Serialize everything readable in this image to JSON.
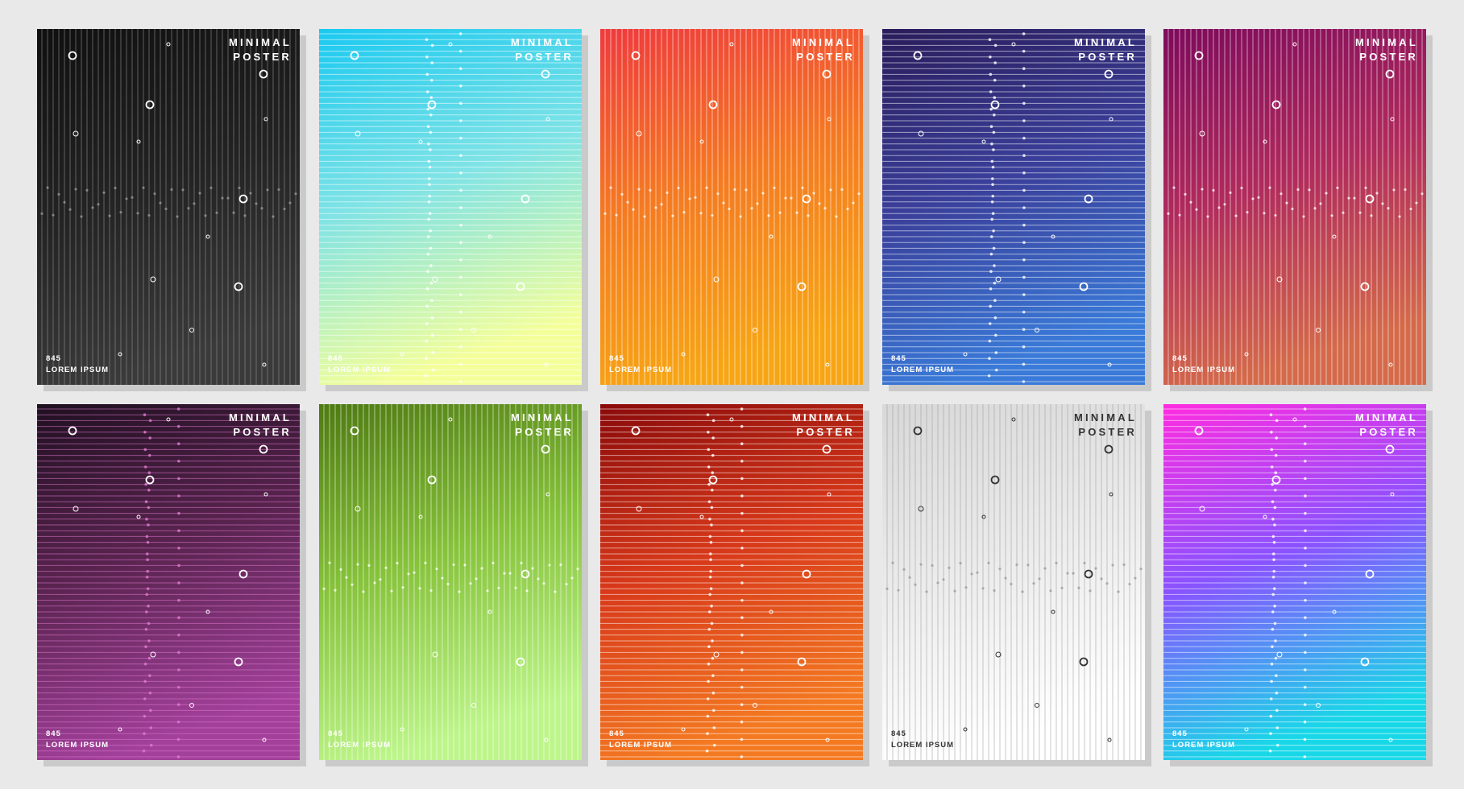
{
  "posters": [
    {
      "id": "black",
      "title_line1": "MINIMAL",
      "title_line2": "POSTER",
      "number": "845",
      "caption": "LOREM IPSUM",
      "orientation": "vertical",
      "gradient": [
        "#101010",
        "#222222",
        "#3a3a3a"
      ],
      "line_color": "#9a9a9a",
      "text_color": "#ffffff",
      "circle_color": "#ffffff"
    },
    {
      "id": "cyan",
      "title_line1": "MINIMAL",
      "title_line2": "POSTER",
      "number": "845",
      "caption": "LOREM IPSUM",
      "orientation": "horizontal",
      "gradient": [
        "#1ac9f0",
        "#7fe3e6",
        "#f4ff9a"
      ],
      "line_color": "#ffffff",
      "text_color": "#ffffff",
      "circle_color": "#ffffff"
    },
    {
      "id": "orange",
      "title_line1": "MINIMAL",
      "title_line2": "POSTER",
      "number": "845",
      "caption": "LOREM IPSUM",
      "orientation": "vertical",
      "gradient": [
        "#ef3a3d",
        "#f47a22",
        "#f7a514"
      ],
      "line_color": "#ffffff",
      "text_color": "#ffffff",
      "circle_color": "#ffffff"
    },
    {
      "id": "indigo",
      "title_line1": "MINIMAL",
      "title_line2": "POSTER",
      "number": "845",
      "caption": "LOREM IPSUM",
      "orientation": "horizontal",
      "gradient": [
        "#2a1c5a",
        "#3a3f9a",
        "#3a7ad8"
      ],
      "line_color": "#ffffff",
      "text_color": "#ffffff",
      "circle_color": "#ffffff"
    },
    {
      "id": "magenta",
      "title_line1": "MINIMAL",
      "title_line2": "POSTER",
      "number": "845",
      "caption": "LOREM IPSUM",
      "orientation": "vertical",
      "gradient": [
        "#7e0a5c",
        "#b02a5c",
        "#d46a4a"
      ],
      "line_color": "#ffffff",
      "text_color": "#ffffff",
      "circle_color": "#ffffff"
    },
    {
      "id": "plum",
      "title_line1": "MINIMAL",
      "title_line2": "POSTER",
      "number": "845",
      "caption": "LOREM IPSUM",
      "orientation": "horizontal",
      "gradient": [
        "#1f1020",
        "#5a2450",
        "#a2409a"
      ],
      "line_color": "#e07ad0",
      "text_color": "#ffffff",
      "circle_color": "#ffffff"
    },
    {
      "id": "green",
      "title_line1": "MINIMAL",
      "title_line2": "POSTER",
      "number": "845",
      "caption": "LOREM IPSUM",
      "orientation": "vertical",
      "gradient": [
        "#4e7a12",
        "#86c23a",
        "#bdf58a"
      ],
      "line_color": "#ffffff",
      "text_color": "#ffffff",
      "circle_color": "#ffffff"
    },
    {
      "id": "red",
      "title_line1": "MINIMAL",
      "title_line2": "POSTER",
      "number": "845",
      "caption": "LOREM IPSUM",
      "orientation": "horizontal",
      "gradient": [
        "#8a0a0a",
        "#d8391a",
        "#f47a22"
      ],
      "line_color": "#ffffff",
      "text_color": "#ffffff",
      "circle_color": "#ffffff"
    },
    {
      "id": "white",
      "title_line1": "MINIMAL",
      "title_line2": "POSTER",
      "number": "845",
      "caption": "LOREM IPSUM",
      "orientation": "vertical",
      "gradient": [
        "#d8d8d8",
        "#ebebeb",
        "#ffffff"
      ],
      "line_color": "#9a9a9a",
      "text_color": "#333333",
      "circle_color": "#333333"
    },
    {
      "id": "neon",
      "title_line1": "MINIMAL",
      "title_line2": "POSTER",
      "number": "845",
      "caption": "LOREM IPSUM",
      "orientation": "horizontal",
      "gradient": [
        "#ff2ce0",
        "#8a52ff",
        "#18d8e8"
      ],
      "line_color": "#ffffff",
      "text_color": "#ffffff",
      "circle_color": "#ffffff"
    }
  ]
}
